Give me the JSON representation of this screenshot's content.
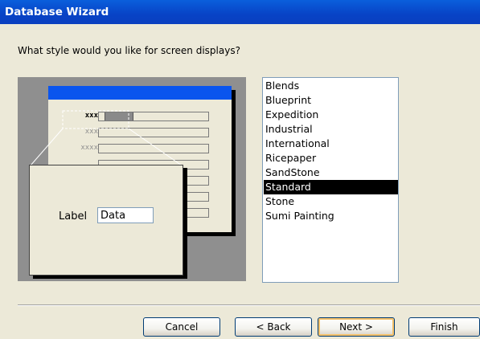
{
  "window": {
    "title": "Database Wizard"
  },
  "prompt": "What style would you like for screen displays?",
  "preview": {
    "mini_labels": [
      "xxx",
      "xxx",
      "xxxx"
    ],
    "label_text": "Label",
    "data_text": "Data"
  },
  "styles": {
    "items": [
      "Blends",
      "Blueprint",
      "Expedition",
      "Industrial",
      "International",
      "Ricepaper",
      "SandStone",
      "Standard",
      "Stone",
      "Sumi Painting"
    ],
    "selected": "Standard"
  },
  "buttons": {
    "cancel": "Cancel",
    "back": "< Back",
    "next": "Next >",
    "finish": "Finish"
  }
}
